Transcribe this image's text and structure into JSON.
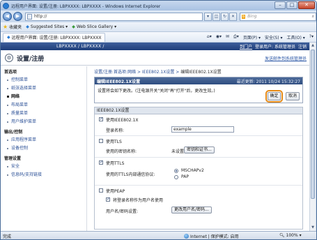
{
  "window": {
    "title": "远程用户界面: 设置/注册: LBPXXXX: LBPXXXX - Windows Internet Explorer",
    "controls": {
      "minimize": "–",
      "maximize": "□",
      "close": "✕"
    }
  },
  "addressbar": {
    "url": "http://",
    "search_placeholder": "Bing",
    "search_brand": "b",
    "back_icon": "◀",
    "forward_icon": "▶"
  },
  "favorites": {
    "favorites_label": "收藏夹",
    "items": [
      "Suggested Sites ▾",
      "Web Slice Gallery ▾"
    ]
  },
  "commandbar": {
    "tab_label": "远程用户界面: 设置/注册: LBPXXXX: LBPXXXX",
    "commands": [
      "页面(P) ▾",
      "安全(S) ▾",
      "工具(O) ▾",
      "?▾"
    ]
  },
  "header": {
    "device": "LBPXXXX / LBPXXXX /",
    "portal_link": "到门户",
    "login_text": "登录用户: 系统管理员",
    "logout": "注销"
  },
  "titlearea": {
    "title": "设置/注册",
    "mail_link": "发送邮件到系统管理员"
  },
  "sidebar": {
    "sections": [
      {
        "title": "首选项",
        "items": [
          "控制菜单",
          "纸张选择菜单",
          "网络",
          "布局菜单",
          "质量菜单",
          "用户维护菜单"
        ]
      },
      {
        "title": "输出/控制",
        "items": [
          "应用程序菜单",
          "设备控制"
        ]
      },
      {
        "title": "管理设置",
        "items": [
          "安全",
          "信息码/支持链接"
        ]
      }
    ],
    "active_item": "网络"
  },
  "breadcrumb": {
    "path": "设置/注册:首选项:网络 > IEEE802.1X设置 > ",
    "current": "编辑IEEE802.1X设置"
  },
  "panel": {
    "title": "编辑IEEE802.1X设置",
    "updated": "最近更新: 2011 10/24 15:32:27",
    "message": "设置将会如下更改。(注电源开关\"关闭\"再\"打开\"后，更改生效。)",
    "ok_button": "确定",
    "cancel_button": "取消"
  },
  "settings": {
    "section_title": "IEEE802.1X设置",
    "use_ieee": {
      "label": "使用IEEE802.1X",
      "checked": true
    },
    "login_name_label": "登录名称:",
    "login_name_value": "example",
    "use_tls": {
      "label": "使用TLS",
      "checked": false
    },
    "tls_key_label": "使用的密钥名称:",
    "tls_key_value": "未设置",
    "key_cert_button": "密钥和证书...",
    "use_ttls": {
      "label": "使用TTLS",
      "checked": true
    },
    "ttls_protocol_label": "使用的TTLS内部通信协议:",
    "protocols": [
      {
        "label": "MSCHAPv2",
        "selected": true
      },
      {
        "label": "PAP",
        "selected": false
      }
    ],
    "use_peap": {
      "label": "使用PEAP",
      "checked": false
    },
    "use_login_as_user": {
      "label": "将登录名称作为用户名使用",
      "checked": true
    },
    "userpass_label": "用户名/密码设置:",
    "change_userpass_button": "更改用户名/密码..."
  },
  "statusbar": {
    "left": "完成",
    "zone": "Internet | 保护模式: 启用",
    "zoom": "100%"
  }
}
